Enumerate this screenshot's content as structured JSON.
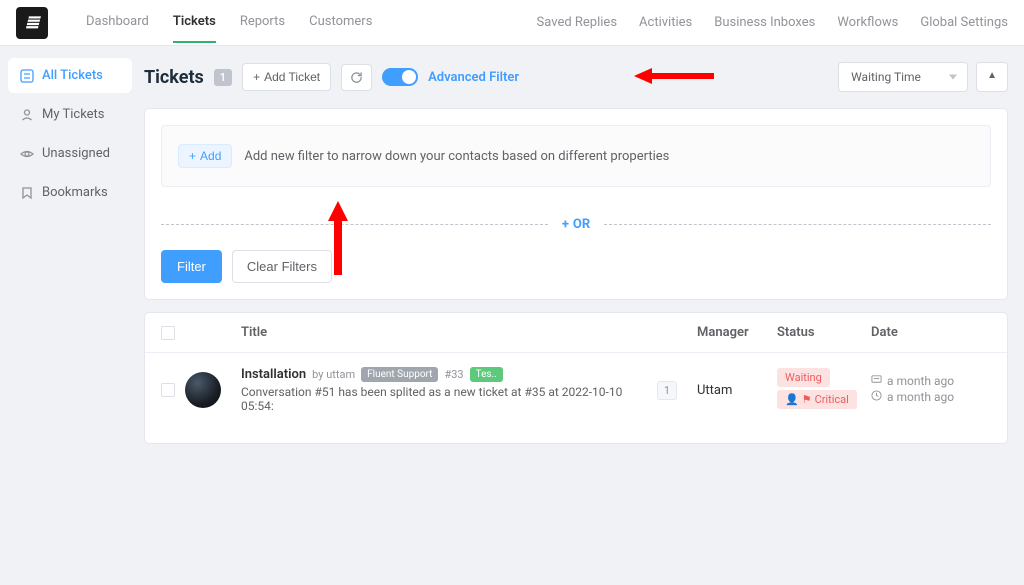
{
  "topnav": {
    "left": [
      "Dashboard",
      "Tickets",
      "Reports",
      "Customers"
    ],
    "active_index": 1,
    "right": [
      "Saved Replies",
      "Activities",
      "Business Inboxes",
      "Workflows",
      "Global Settings"
    ]
  },
  "sidebar": {
    "items": [
      {
        "label": "All Tickets",
        "icon": "list-icon",
        "active": true
      },
      {
        "label": "My Tickets",
        "icon": "person-icon",
        "active": false
      },
      {
        "label": "Unassigned",
        "icon": "eye-icon",
        "active": false
      },
      {
        "label": "Bookmarks",
        "icon": "bookmark-icon",
        "active": false
      }
    ]
  },
  "header": {
    "title": "Tickets",
    "count": "1",
    "add_ticket": "Add Ticket",
    "adv_filter": "Advanced Filter",
    "sort_select": "Waiting Time",
    "sort_dir": "▲"
  },
  "filter_panel": {
    "add_btn": "Add",
    "desc": "Add new filter to narrow down your contacts based on different properties",
    "or_label": "OR",
    "filter_btn": "Filter",
    "clear_btn": "Clear Filters"
  },
  "table": {
    "headers": {
      "title": "Title",
      "manager": "Manager",
      "status": "Status",
      "date": "Date"
    },
    "rows": [
      {
        "title": "Installation",
        "by_prefix": "by",
        "author": "uttam",
        "product_tag": "Fluent Support",
        "id": "#33",
        "extra_tag": "Tes..",
        "excerpt": "Conversation #51 has been splited as a new ticket at #35 at 2022-10-10 05:54:",
        "msg_count": "1",
        "manager": "Uttam",
        "status_1": "Waiting",
        "status_2": "Critical",
        "date_1": "a month ago",
        "date_2": "a month ago"
      }
    ]
  }
}
